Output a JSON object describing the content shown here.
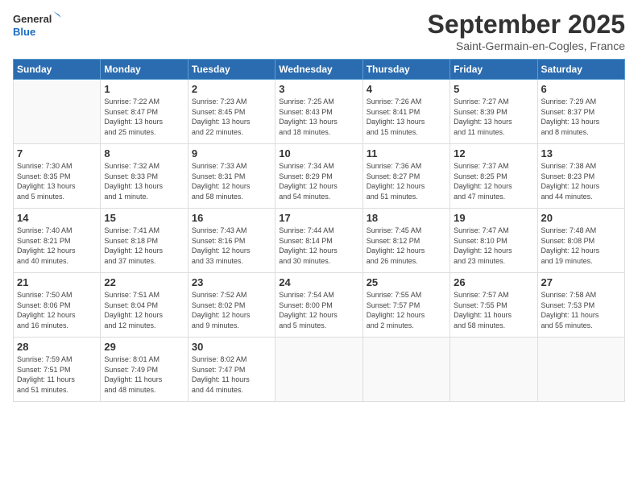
{
  "logo": {
    "line1": "General",
    "line2": "Blue"
  },
  "title": "September 2025",
  "location": "Saint-Germain-en-Cogles, France",
  "days_of_week": [
    "Sunday",
    "Monday",
    "Tuesday",
    "Wednesday",
    "Thursday",
    "Friday",
    "Saturday"
  ],
  "weeks": [
    [
      {
        "day": "",
        "info": ""
      },
      {
        "day": "1",
        "info": "Sunrise: 7:22 AM\nSunset: 8:47 PM\nDaylight: 13 hours\nand 25 minutes."
      },
      {
        "day": "2",
        "info": "Sunrise: 7:23 AM\nSunset: 8:45 PM\nDaylight: 13 hours\nand 22 minutes."
      },
      {
        "day": "3",
        "info": "Sunrise: 7:25 AM\nSunset: 8:43 PM\nDaylight: 13 hours\nand 18 minutes."
      },
      {
        "day": "4",
        "info": "Sunrise: 7:26 AM\nSunset: 8:41 PM\nDaylight: 13 hours\nand 15 minutes."
      },
      {
        "day": "5",
        "info": "Sunrise: 7:27 AM\nSunset: 8:39 PM\nDaylight: 13 hours\nand 11 minutes."
      },
      {
        "day": "6",
        "info": "Sunrise: 7:29 AM\nSunset: 8:37 PM\nDaylight: 13 hours\nand 8 minutes."
      }
    ],
    [
      {
        "day": "7",
        "info": "Sunrise: 7:30 AM\nSunset: 8:35 PM\nDaylight: 13 hours\nand 5 minutes."
      },
      {
        "day": "8",
        "info": "Sunrise: 7:32 AM\nSunset: 8:33 PM\nDaylight: 13 hours\nand 1 minute."
      },
      {
        "day": "9",
        "info": "Sunrise: 7:33 AM\nSunset: 8:31 PM\nDaylight: 12 hours\nand 58 minutes."
      },
      {
        "day": "10",
        "info": "Sunrise: 7:34 AM\nSunset: 8:29 PM\nDaylight: 12 hours\nand 54 minutes."
      },
      {
        "day": "11",
        "info": "Sunrise: 7:36 AM\nSunset: 8:27 PM\nDaylight: 12 hours\nand 51 minutes."
      },
      {
        "day": "12",
        "info": "Sunrise: 7:37 AM\nSunset: 8:25 PM\nDaylight: 12 hours\nand 47 minutes."
      },
      {
        "day": "13",
        "info": "Sunrise: 7:38 AM\nSunset: 8:23 PM\nDaylight: 12 hours\nand 44 minutes."
      }
    ],
    [
      {
        "day": "14",
        "info": "Sunrise: 7:40 AM\nSunset: 8:21 PM\nDaylight: 12 hours\nand 40 minutes."
      },
      {
        "day": "15",
        "info": "Sunrise: 7:41 AM\nSunset: 8:18 PM\nDaylight: 12 hours\nand 37 minutes."
      },
      {
        "day": "16",
        "info": "Sunrise: 7:43 AM\nSunset: 8:16 PM\nDaylight: 12 hours\nand 33 minutes."
      },
      {
        "day": "17",
        "info": "Sunrise: 7:44 AM\nSunset: 8:14 PM\nDaylight: 12 hours\nand 30 minutes."
      },
      {
        "day": "18",
        "info": "Sunrise: 7:45 AM\nSunset: 8:12 PM\nDaylight: 12 hours\nand 26 minutes."
      },
      {
        "day": "19",
        "info": "Sunrise: 7:47 AM\nSunset: 8:10 PM\nDaylight: 12 hours\nand 23 minutes."
      },
      {
        "day": "20",
        "info": "Sunrise: 7:48 AM\nSunset: 8:08 PM\nDaylight: 12 hours\nand 19 minutes."
      }
    ],
    [
      {
        "day": "21",
        "info": "Sunrise: 7:50 AM\nSunset: 8:06 PM\nDaylight: 12 hours\nand 16 minutes."
      },
      {
        "day": "22",
        "info": "Sunrise: 7:51 AM\nSunset: 8:04 PM\nDaylight: 12 hours\nand 12 minutes."
      },
      {
        "day": "23",
        "info": "Sunrise: 7:52 AM\nSunset: 8:02 PM\nDaylight: 12 hours\nand 9 minutes."
      },
      {
        "day": "24",
        "info": "Sunrise: 7:54 AM\nSunset: 8:00 PM\nDaylight: 12 hours\nand 5 minutes."
      },
      {
        "day": "25",
        "info": "Sunrise: 7:55 AM\nSunset: 7:57 PM\nDaylight: 12 hours\nand 2 minutes."
      },
      {
        "day": "26",
        "info": "Sunrise: 7:57 AM\nSunset: 7:55 PM\nDaylight: 11 hours\nand 58 minutes."
      },
      {
        "day": "27",
        "info": "Sunrise: 7:58 AM\nSunset: 7:53 PM\nDaylight: 11 hours\nand 55 minutes."
      }
    ],
    [
      {
        "day": "28",
        "info": "Sunrise: 7:59 AM\nSunset: 7:51 PM\nDaylight: 11 hours\nand 51 minutes."
      },
      {
        "day": "29",
        "info": "Sunrise: 8:01 AM\nSunset: 7:49 PM\nDaylight: 11 hours\nand 48 minutes."
      },
      {
        "day": "30",
        "info": "Sunrise: 8:02 AM\nSunset: 7:47 PM\nDaylight: 11 hours\nand 44 minutes."
      },
      {
        "day": "",
        "info": ""
      },
      {
        "day": "",
        "info": ""
      },
      {
        "day": "",
        "info": ""
      },
      {
        "day": "",
        "info": ""
      }
    ]
  ]
}
